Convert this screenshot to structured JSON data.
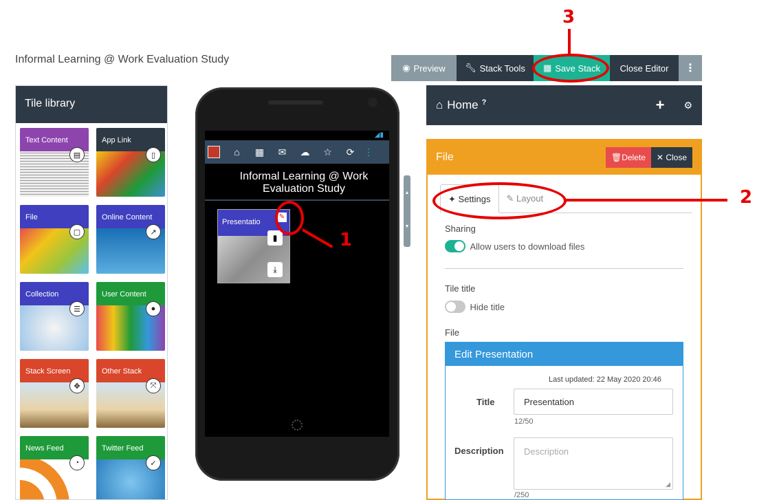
{
  "page": {
    "title": "Informal Learning @ Work Evaluation Study"
  },
  "toolbar": {
    "preview": "Preview",
    "stack_tools": "Stack Tools",
    "save_stack": "Save Stack",
    "close_editor": "Close Editor",
    "more": "⋮"
  },
  "tile_library": {
    "title": "Tile library",
    "tiles": [
      {
        "label": "Text Content",
        "color": "#8e44ad",
        "icon": "document-icon"
      },
      {
        "label": "App Link",
        "color": "#2d3a45",
        "icon": "mobile-icon"
      },
      {
        "label": "File",
        "color": "#3f3fbf",
        "icon": "file-icon"
      },
      {
        "label": "Online Content",
        "color": "#3f3fbf",
        "icon": "external-link-icon"
      },
      {
        "label": "Collection",
        "color": "#3f3fbf",
        "icon": "list-icon"
      },
      {
        "label": "User Content",
        "color": "#1e9a3a",
        "icon": "user-icon"
      },
      {
        "label": "Stack Screen",
        "color": "#d9462b",
        "icon": "move-icon"
      },
      {
        "label": "Other Stack",
        "color": "#d9462b",
        "icon": "expand-icon"
      },
      {
        "label": "News Feed",
        "color": "#1e9a3a",
        "icon": "rss-icon"
      },
      {
        "label": "Twitter Feed",
        "color": "#1e9a3a",
        "icon": "twitter-icon"
      }
    ]
  },
  "phone": {
    "app_title": "Informal Learning @ Work Evaluation Study",
    "tile_label": "Presentatio"
  },
  "home_bar": {
    "title": "Home",
    "help": "?",
    "add": "+"
  },
  "file_panel": {
    "title": "File",
    "delete": "Delete",
    "close": "Close",
    "tabs": {
      "settings": "Settings",
      "layout": "Layout"
    },
    "sharing_label": "Sharing",
    "allow_download": "Allow users to download files",
    "tile_title_label": "Tile title",
    "hide_title": "Hide title",
    "file_label": "File",
    "edit": {
      "header": "Edit Presentation",
      "last_updated": "Last updated: 22 May 2020 20:46",
      "title_label": "Title",
      "title_value": "Presentation",
      "title_count": "12/50",
      "description_label": "Description",
      "description_placeholder": "Description",
      "description_count": "/250"
    }
  },
  "annotations": {
    "one": "1",
    "two": "2",
    "three": "3"
  },
  "colors": {
    "accent_red": "#e60000",
    "teal": "#1bb394",
    "navy": "#2d3a45",
    "orange": "#f0a020",
    "blue": "#3498db"
  }
}
